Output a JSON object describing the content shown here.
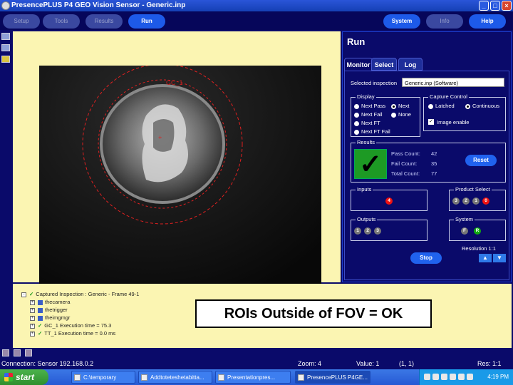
{
  "window": {
    "title": "PresencePLUS P4 GEO Vision Sensor - Generic.inp",
    "buttons": {
      "minimize": "_",
      "maximize": "□",
      "close": "×"
    }
  },
  "topnav": {
    "items": [
      {
        "label": "Setup",
        "active": false
      },
      {
        "label": "Tools",
        "active": false
      },
      {
        "label": "Results",
        "active": false
      },
      {
        "label": "Run",
        "active": true
      },
      {
        "label": "System",
        "active": true
      },
      {
        "label": "Info",
        "active": false
      },
      {
        "label": "Help",
        "active": true
      }
    ]
  },
  "image": {
    "roi_label": "GC_1"
  },
  "run_panel": {
    "title": "Run",
    "tabs": [
      {
        "label": "Monitor",
        "active": true
      },
      {
        "label": "Select",
        "active": false
      },
      {
        "label": "Log",
        "active": false
      }
    ],
    "selected_inspection": {
      "label": "Selected inspection",
      "value": "Generic.inp (Software)"
    },
    "display": {
      "label": "Display",
      "options": [
        {
          "label": "Next Pass",
          "selected": false
        },
        {
          "label": "Next",
          "selected": true
        },
        {
          "label": "Next Fail",
          "selected": false
        },
        {
          "label": "None",
          "selected": false
        },
        {
          "label": "Next FT",
          "selected": false
        },
        {
          "label": "Next FT Fail",
          "selected": false
        }
      ]
    },
    "capture_control": {
      "label": "Capture Control",
      "options": [
        {
          "label": "Latched",
          "selected": false
        },
        {
          "label": "Continuous",
          "selected": true
        }
      ],
      "image_enable": {
        "label": "Image enable",
        "checked": true,
        "mark": "✓"
      }
    },
    "results": {
      "label": "Results",
      "status_mark": "✓",
      "pass_count": {
        "label": "Pass Count:",
        "value": "42"
      },
      "fail_count": {
        "label": "Fail Count:",
        "value": "35"
      },
      "total_count": {
        "label": "Total Count:",
        "value": "77"
      },
      "reset_label": "Reset"
    },
    "inputs": {
      "label": "Inputs",
      "pins": [
        {
          "num": "4",
          "color": "#e11111"
        }
      ]
    },
    "product_select": {
      "label": "Product Select",
      "pins": [
        "3",
        "2",
        "1",
        "0"
      ]
    },
    "outputs": {
      "label": "Outputs",
      "pins": [
        "1",
        "2",
        "3"
      ]
    },
    "system": {
      "label": "System",
      "pins": [
        {
          "num": "F",
          "color": "#777777"
        },
        {
          "num": "R",
          "color": "#11aa11"
        }
      ]
    },
    "resolution": "Resolution 1:1",
    "stop_label": "Stop"
  },
  "tree": {
    "lines": [
      {
        "text": "Captured Inspection : Generic - Frame 49-1",
        "indent": 0,
        "check": "✓"
      },
      {
        "text": "thecamera",
        "indent": 1,
        "check": "✓"
      },
      {
        "text": "thetrigger",
        "indent": 1,
        "check": "✓"
      },
      {
        "text": "theimgmgr",
        "indent": 1,
        "check": "✓"
      },
      {
        "text": "GC_1 Execution time = 75.3",
        "indent": 1,
        "check": "✓"
      },
      {
        "text": "TT_1 Execution time = 0.0 ms",
        "indent": 1,
        "check": "✓"
      }
    ]
  },
  "caption": "ROIs Outside of FOV = OK",
  "statusbar": {
    "connection": "Connection: Sensor 192.168.0.2",
    "zoom": "Zoom:  4",
    "value": "Value:  1",
    "coord": "(1, 1)",
    "res": "Res:  1:1"
  },
  "taskbar": {
    "start_label": "start",
    "tasks": [
      {
        "label": "C:\\temporary",
        "active": false
      },
      {
        "label": "Addtoteteshetabitta...",
        "active": false
      },
      {
        "label": "Presentationpres...",
        "active": false
      },
      {
        "label": "PresencePLUS P4GE...",
        "active": true
      }
    ],
    "clock": "4:19 PM"
  }
}
